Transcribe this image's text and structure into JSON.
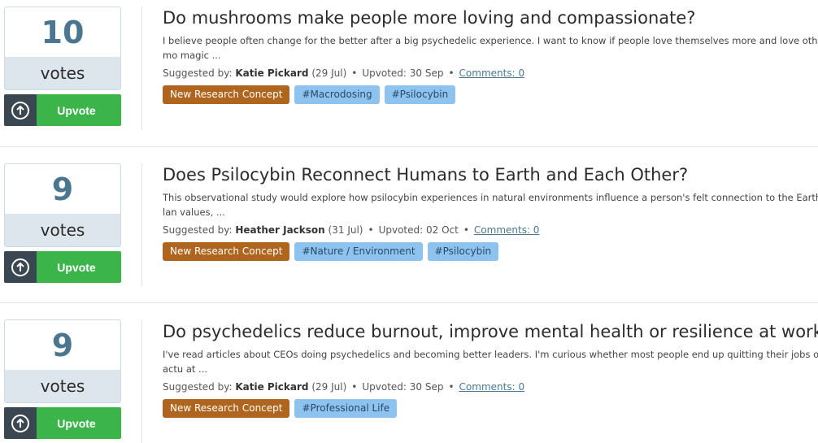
{
  "labels": {
    "votes": "votes",
    "upvote": "Upvote",
    "suggested_by": "Suggested by:",
    "upvoted": "Upvoted:",
    "comments": "Comments: 0"
  },
  "items": [
    {
      "votes": "10",
      "title": "Do mushrooms make people more loving and compassionate?",
      "description": "I believe people often change for the better after a big psychedelic experience. I want to know if people love themselves more and love others mo magic ...",
      "author": "Katie Pickard",
      "suggested_date": "(29 Jul)",
      "upvoted_date": "30 Sep",
      "comments": "Comments: 0",
      "tags": [
        "New Research Concept",
        "#Macrodosing",
        "#Psilocybin"
      ]
    },
    {
      "votes": "9",
      "title": "Does Psilocybin Reconnect Humans to Earth and Each Other?",
      "description": "This observational study would explore how psilocybin experiences in natural environments influence a person's felt connection to the Earth, lan values, ...",
      "author": "Heather Jackson",
      "suggested_date": "(31 Jul)",
      "upvoted_date": "02 Oct",
      "comments": "Comments: 0",
      "tags": [
        "New Research Concept",
        "#Nature / Environment",
        "#Psilocybin"
      ]
    },
    {
      "votes": "9",
      "title": "Do psychedelics reduce burnout, improve mental health or resilience at work?",
      "description": "I've read articles about CEOs doing psychedelics and becoming better leaders. I'm curious whether most people end up quitting their jobs or actu at ...",
      "author": "Katie Pickard",
      "suggested_date": "(29 Jul)",
      "upvoted_date": "30 Sep",
      "comments": "Comments: 0",
      "tags": [
        "New Research Concept",
        "#Professional Life"
      ]
    }
  ],
  "colors": {
    "vote_number": "#4b7690",
    "upvote_green": "#3bb54a",
    "upvote_icon_bg": "#3a4750",
    "tag_concept": "#b0651e",
    "tag_hashtag": "#8ec2ef"
  },
  "icons": {
    "upvote": "arrow-up-circle-icon"
  }
}
